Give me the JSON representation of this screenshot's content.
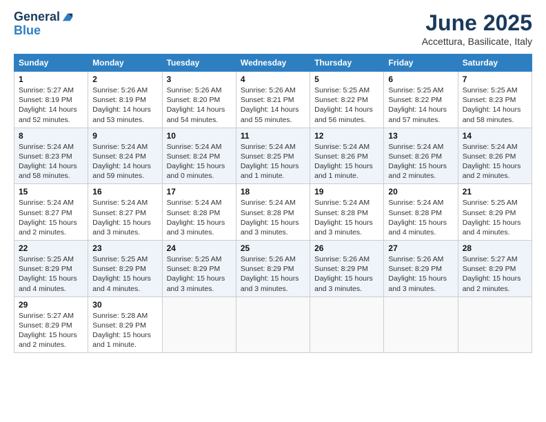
{
  "header": {
    "logo_line1": "General",
    "logo_line2": "Blue",
    "month": "June 2025",
    "location": "Accettura, Basilicate, Italy"
  },
  "columns": [
    "Sunday",
    "Monday",
    "Tuesday",
    "Wednesday",
    "Thursday",
    "Friday",
    "Saturday"
  ],
  "weeks": [
    [
      {
        "day": "1",
        "sunrise": "Sunrise: 5:27 AM",
        "sunset": "Sunset: 8:19 PM",
        "daylight": "Daylight: 14 hours and 52 minutes."
      },
      {
        "day": "2",
        "sunrise": "Sunrise: 5:26 AM",
        "sunset": "Sunset: 8:19 PM",
        "daylight": "Daylight: 14 hours and 53 minutes."
      },
      {
        "day": "3",
        "sunrise": "Sunrise: 5:26 AM",
        "sunset": "Sunset: 8:20 PM",
        "daylight": "Daylight: 14 hours and 54 minutes."
      },
      {
        "day": "4",
        "sunrise": "Sunrise: 5:26 AM",
        "sunset": "Sunset: 8:21 PM",
        "daylight": "Daylight: 14 hours and 55 minutes."
      },
      {
        "day": "5",
        "sunrise": "Sunrise: 5:25 AM",
        "sunset": "Sunset: 8:22 PM",
        "daylight": "Daylight: 14 hours and 56 minutes."
      },
      {
        "day": "6",
        "sunrise": "Sunrise: 5:25 AM",
        "sunset": "Sunset: 8:22 PM",
        "daylight": "Daylight: 14 hours and 57 minutes."
      },
      {
        "day": "7",
        "sunrise": "Sunrise: 5:25 AM",
        "sunset": "Sunset: 8:23 PM",
        "daylight": "Daylight: 14 hours and 58 minutes."
      }
    ],
    [
      {
        "day": "8",
        "sunrise": "Sunrise: 5:24 AM",
        "sunset": "Sunset: 8:23 PM",
        "daylight": "Daylight: 14 hours and 58 minutes."
      },
      {
        "day": "9",
        "sunrise": "Sunrise: 5:24 AM",
        "sunset": "Sunset: 8:24 PM",
        "daylight": "Daylight: 14 hours and 59 minutes."
      },
      {
        "day": "10",
        "sunrise": "Sunrise: 5:24 AM",
        "sunset": "Sunset: 8:24 PM",
        "daylight": "Daylight: 15 hours and 0 minutes."
      },
      {
        "day": "11",
        "sunrise": "Sunrise: 5:24 AM",
        "sunset": "Sunset: 8:25 PM",
        "daylight": "Daylight: 15 hours and 1 minute."
      },
      {
        "day": "12",
        "sunrise": "Sunrise: 5:24 AM",
        "sunset": "Sunset: 8:26 PM",
        "daylight": "Daylight: 15 hours and 1 minute."
      },
      {
        "day": "13",
        "sunrise": "Sunrise: 5:24 AM",
        "sunset": "Sunset: 8:26 PM",
        "daylight": "Daylight: 15 hours and 2 minutes."
      },
      {
        "day": "14",
        "sunrise": "Sunrise: 5:24 AM",
        "sunset": "Sunset: 8:26 PM",
        "daylight": "Daylight: 15 hours and 2 minutes."
      }
    ],
    [
      {
        "day": "15",
        "sunrise": "Sunrise: 5:24 AM",
        "sunset": "Sunset: 8:27 PM",
        "daylight": "Daylight: 15 hours and 2 minutes."
      },
      {
        "day": "16",
        "sunrise": "Sunrise: 5:24 AM",
        "sunset": "Sunset: 8:27 PM",
        "daylight": "Daylight: 15 hours and 3 minutes."
      },
      {
        "day": "17",
        "sunrise": "Sunrise: 5:24 AM",
        "sunset": "Sunset: 8:28 PM",
        "daylight": "Daylight: 15 hours and 3 minutes."
      },
      {
        "day": "18",
        "sunrise": "Sunrise: 5:24 AM",
        "sunset": "Sunset: 8:28 PM",
        "daylight": "Daylight: 15 hours and 3 minutes."
      },
      {
        "day": "19",
        "sunrise": "Sunrise: 5:24 AM",
        "sunset": "Sunset: 8:28 PM",
        "daylight": "Daylight: 15 hours and 3 minutes."
      },
      {
        "day": "20",
        "sunrise": "Sunrise: 5:24 AM",
        "sunset": "Sunset: 8:28 PM",
        "daylight": "Daylight: 15 hours and 4 minutes."
      },
      {
        "day": "21",
        "sunrise": "Sunrise: 5:25 AM",
        "sunset": "Sunset: 8:29 PM",
        "daylight": "Daylight: 15 hours and 4 minutes."
      }
    ],
    [
      {
        "day": "22",
        "sunrise": "Sunrise: 5:25 AM",
        "sunset": "Sunset: 8:29 PM",
        "daylight": "Daylight: 15 hours and 4 minutes."
      },
      {
        "day": "23",
        "sunrise": "Sunrise: 5:25 AM",
        "sunset": "Sunset: 8:29 PM",
        "daylight": "Daylight: 15 hours and 4 minutes."
      },
      {
        "day": "24",
        "sunrise": "Sunrise: 5:25 AM",
        "sunset": "Sunset: 8:29 PM",
        "daylight": "Daylight: 15 hours and 3 minutes."
      },
      {
        "day": "25",
        "sunrise": "Sunrise: 5:26 AM",
        "sunset": "Sunset: 8:29 PM",
        "daylight": "Daylight: 15 hours and 3 minutes."
      },
      {
        "day": "26",
        "sunrise": "Sunrise: 5:26 AM",
        "sunset": "Sunset: 8:29 PM",
        "daylight": "Daylight: 15 hours and 3 minutes."
      },
      {
        "day": "27",
        "sunrise": "Sunrise: 5:26 AM",
        "sunset": "Sunset: 8:29 PM",
        "daylight": "Daylight: 15 hours and 3 minutes."
      },
      {
        "day": "28",
        "sunrise": "Sunrise: 5:27 AM",
        "sunset": "Sunset: 8:29 PM",
        "daylight": "Daylight: 15 hours and 2 minutes."
      }
    ],
    [
      {
        "day": "29",
        "sunrise": "Sunrise: 5:27 AM",
        "sunset": "Sunset: 8:29 PM",
        "daylight": "Daylight: 15 hours and 2 minutes."
      },
      {
        "day": "30",
        "sunrise": "Sunrise: 5:28 AM",
        "sunset": "Sunset: 8:29 PM",
        "daylight": "Daylight: 15 hours and 1 minute."
      },
      null,
      null,
      null,
      null,
      null
    ]
  ]
}
